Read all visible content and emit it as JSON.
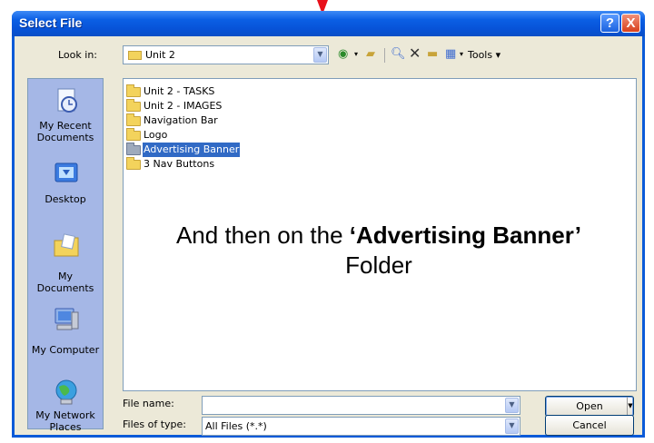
{
  "window": {
    "title": "Select File",
    "help_glyph": "?",
    "close_glyph": "X"
  },
  "look_in": {
    "label": "Look in:",
    "value": "Unit 2"
  },
  "toolbar": {
    "tools_label": "Tools"
  },
  "places": [
    {
      "label": "My Recent Documents",
      "icon": "recent-documents-icon"
    },
    {
      "label": "Desktop",
      "icon": "desktop-icon"
    },
    {
      "label": "My Documents",
      "icon": "my-documents-icon"
    },
    {
      "label": "My Computer",
      "icon": "my-computer-icon"
    },
    {
      "label": "My Network Places",
      "icon": "network-places-icon"
    }
  ],
  "folders": [
    {
      "name": "Unit 2 - TASKS",
      "selected": false
    },
    {
      "name": "Unit 2 - IMAGES",
      "selected": false
    },
    {
      "name": "Navigation Bar",
      "selected": false
    },
    {
      "name": "Logo",
      "selected": false
    },
    {
      "name": "Advertising Banner",
      "selected": true
    },
    {
      "name": "3 Nav Buttons",
      "selected": false
    }
  ],
  "instruction": {
    "prefix": "And then on the ",
    "emphasis": "‘Advertising Banner’",
    "suffix": "Folder"
  },
  "file_name": {
    "label": "File name:",
    "value": ""
  },
  "files_of_type": {
    "label": "Files of type:",
    "value": "All Files (*.*)"
  },
  "buttons": {
    "open": "Open",
    "cancel": "Cancel"
  },
  "colors": {
    "titlebar": "#0b5fe4",
    "selection": "#316ac5",
    "places_bar": "#a5b7e6",
    "arrow": "#e8101a"
  }
}
